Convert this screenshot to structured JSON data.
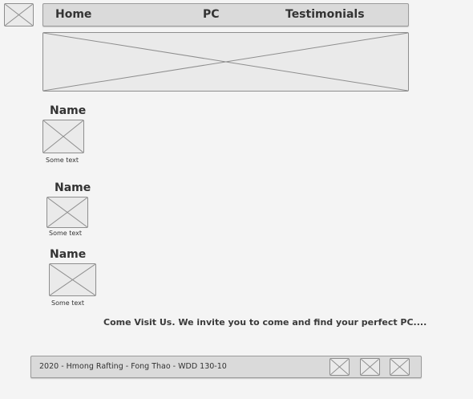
{
  "header": {
    "logo_icon": "image-placeholder-icon",
    "nav": {
      "home": "Home",
      "pc": "PC",
      "testimonials": "Testimonials"
    }
  },
  "hero": {
    "image_icon": "image-placeholder-icon"
  },
  "testimonials": [
    {
      "name": "Name",
      "caption": "Some text",
      "image_icon": "image-placeholder-icon"
    },
    {
      "name": "Name",
      "caption": "Some text",
      "image_icon": "image-placeholder-icon"
    },
    {
      "name": "Name",
      "caption": "Some text",
      "image_icon": "image-placeholder-icon"
    }
  ],
  "visit": {
    "text": "Come Visit Us. We invite you to come and find your perfect PC...."
  },
  "footer": {
    "text": "2020 - Hmong Rafting - Fong Thao - WDD 130-10",
    "social_icons": [
      "image-placeholder-icon",
      "image-placeholder-icon",
      "image-placeholder-icon"
    ]
  },
  "colors": {
    "background": "#f4f4f4",
    "bar": "#dadada",
    "placeholder": "#eaeaea",
    "stroke": "#8e8e8e",
    "text": "#333333"
  }
}
